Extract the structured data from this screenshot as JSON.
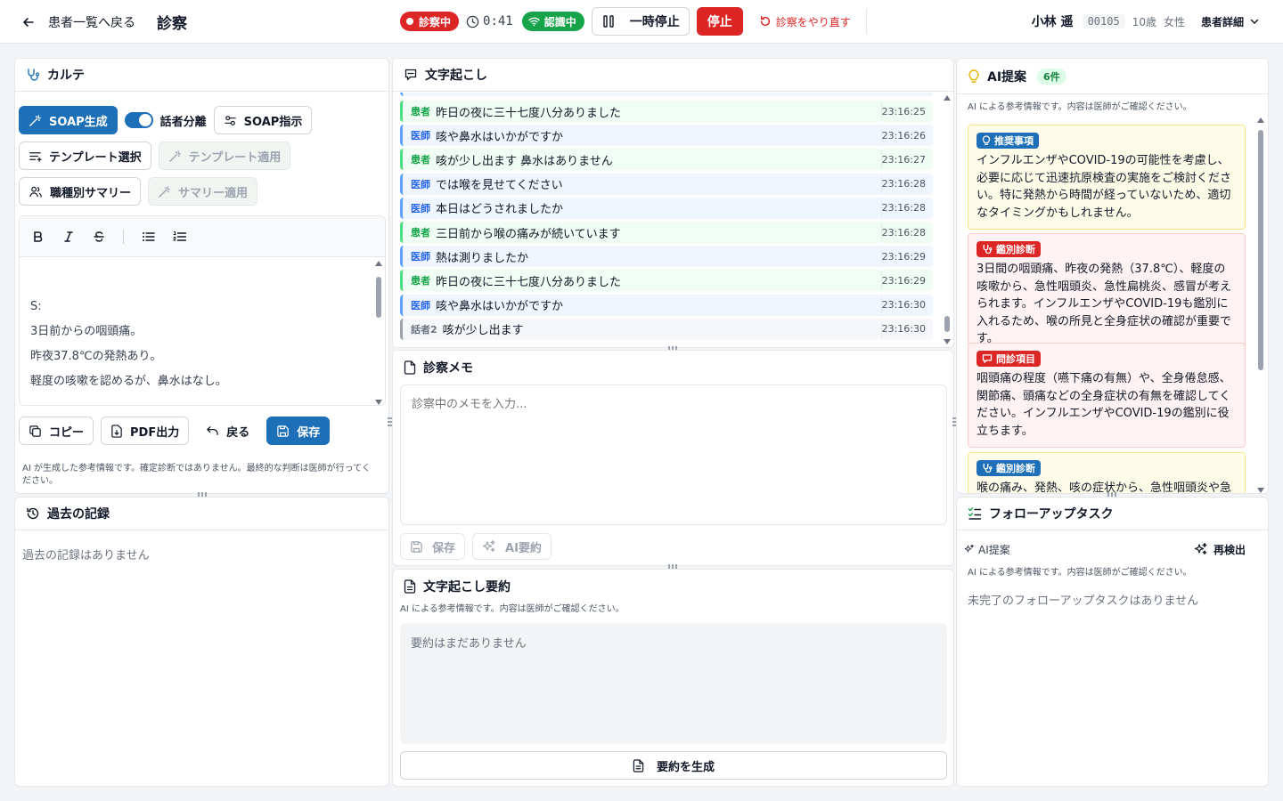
{
  "header": {
    "back_label": "患者一覧へ戻る",
    "title": "診察",
    "status_badge": "診察中",
    "timer": "0:41",
    "recognition_badge": "認識中",
    "pause_label": "一時停止",
    "stop_label": "停止",
    "redo_label": "診察をやり直す",
    "patient_name": "小林 遥",
    "patient_id": "00105",
    "patient_age": "10歳",
    "patient_sex": "女性",
    "patient_detail_label": "患者詳細"
  },
  "karte": {
    "title": "カルテ",
    "soap_generate": "SOAP生成",
    "speaker_separation": "話者分離",
    "speaker_separation_on": true,
    "soap_instruction": "SOAP指示",
    "template_select": "テンプレート選択",
    "template_apply": "テンプレート適用",
    "role_summary": "職種別サマリー",
    "summary_apply": "サマリー適用",
    "content_lines": [
      "S:",
      "3日前からの咽頭痛。",
      "昨夜37.8℃の発熱あり。",
      "軽度の咳嗽を認めるが、鼻水はなし。"
    ],
    "copy": "コピー",
    "pdf": "PDF出力",
    "undo": "戻る",
    "save": "保存",
    "disclaimer": "AI が生成した参考情報です。確定診断ではありません。最終的な判断は医師が行ってください。"
  },
  "history": {
    "title": "過去の記録",
    "empty": "過去の記録はありません"
  },
  "transcript": {
    "title": "文字起こし",
    "rows": [
      {
        "role": "patient",
        "speaker": "患者",
        "text": "昨日の夜に三十七度八分ありました",
        "time": "23:16:25"
      },
      {
        "role": "doctor",
        "speaker": "医師",
        "text": "咳や鼻水はいかがですか",
        "time": "23:16:26"
      },
      {
        "role": "patient",
        "speaker": "患者",
        "text": "咳が少し出ます 鼻水はありません",
        "time": "23:16:27"
      },
      {
        "role": "doctor",
        "speaker": "医師",
        "text": "では喉を見せてください",
        "time": "23:16:28"
      },
      {
        "role": "doctor",
        "speaker": "医師",
        "text": "本日はどうされましたか",
        "time": "23:16:28"
      },
      {
        "role": "patient",
        "speaker": "患者",
        "text": "三日前から喉の痛みが続いています",
        "time": "23:16:28"
      },
      {
        "role": "doctor",
        "speaker": "医師",
        "text": "熱は測りましたか",
        "time": "23:16:29"
      },
      {
        "role": "patient",
        "speaker": "患者",
        "text": "昨日の夜に三十七度八分ありました",
        "time": "23:16:29"
      },
      {
        "role": "doctor",
        "speaker": "医師",
        "text": "咳や鼻水はいかがですか",
        "time": "23:16:30"
      },
      {
        "role": "other",
        "speaker": "話者2",
        "text": "咳が少し出ます",
        "time": "23:16:30"
      }
    ]
  },
  "memo": {
    "title": "診察メモ",
    "placeholder": "診察中のメモを入力...",
    "save": "保存",
    "ai_summary": "AI要約"
  },
  "summary": {
    "title": "文字起こし要約",
    "disclaimer": "AI による参考情報です。内容は医師がご確認ください。",
    "empty": "要約はまだありません",
    "generate": "要約を生成"
  },
  "ai": {
    "title": "AI提案",
    "count": "6件",
    "disclaimer": "AI による参考情報です。内容は医師がご確認ください。",
    "cards": [
      {
        "tag": "推奨事項",
        "tag_color": "blue",
        "card_color": "yellow",
        "icon": "lightbulb-icon",
        "text": "インフルエンザやCOVID-19の可能性を考慮し、必要に応じて迅速抗原検査の実施をご検討ください。特に発熱から時間が経っていないため、適切なタイミングかもしれません。"
      },
      {
        "tag": "鑑別診断",
        "tag_color": "red",
        "card_color": "red",
        "icon": "stethoscope-icon",
        "text": "3日間の咽頭痛、昨夜の発熱（37.8℃）、軽度の咳嗽から、急性咽頭炎、急性扁桃炎、感冒が考えられます。インフルエンザやCOVID-19も鑑別に入れるため、喉の所見と全身症状の確認が重要です。"
      },
      {
        "tag": "問診項目",
        "tag_color": "red",
        "card_color": "red",
        "icon": "chat-icon",
        "text": "咽頭痛の程度（嚥下痛の有無）や、全身倦怠感、関節痛、頭痛などの全身症状の有無を確認してください。インフルエンザやCOVID-19の鑑別に役立ちます。"
      },
      {
        "tag": "鑑別診断",
        "tag_color": "blue",
        "card_color": "yellow",
        "icon": "stethoscope-icon",
        "text": "喉の痛み、発熱、咳の症状から、急性咽頭炎や急性"
      }
    ]
  },
  "followup": {
    "title": "フォローアップタスク",
    "ai_label": "AI提案",
    "redetect": "再検出",
    "disclaimer": "AI による参考情報です。内容は医師がご確認ください。",
    "empty": "未完了のフォローアップタスクはありません"
  },
  "colors": {
    "primary": "#1d6fb8",
    "danger": "#dc2626",
    "success": "#16a34a"
  }
}
